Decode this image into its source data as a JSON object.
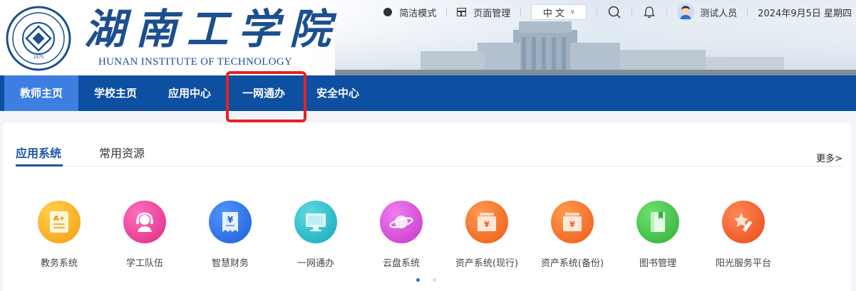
{
  "header": {
    "school_name_cn": "湖南工学院",
    "school_name_en": "HUNAN INSTITUTE OF TECHNOLOGY",
    "seal_year": "1975"
  },
  "topbar": {
    "simple_mode": "简洁模式",
    "page_manage": "页面管理",
    "language": "中 文",
    "user_name": "测试人员",
    "date": "2024年9月5日 星期四"
  },
  "nav": {
    "items": [
      {
        "label": "教师主页",
        "active": true
      },
      {
        "label": "学校主页",
        "active": false
      },
      {
        "label": "应用中心",
        "active": false
      },
      {
        "label": "一网通办",
        "active": false,
        "highlighted": true
      },
      {
        "label": "安全中心",
        "active": false
      }
    ]
  },
  "main": {
    "tabs": [
      {
        "label": "应用系统",
        "active": true
      },
      {
        "label": "常用资源",
        "active": false
      }
    ],
    "more": "更多>",
    "apps": [
      {
        "label": "教务系统",
        "icon": "grade-card-icon",
        "color": "#f5a21b"
      },
      {
        "label": "学工队伍",
        "icon": "headset-user-icon",
        "color": "#e6358f"
      },
      {
        "label": "智慧财务",
        "icon": "finance-receipt-icon",
        "color": "#2d74e6"
      },
      {
        "label": "一网通办",
        "icon": "monitor-icon",
        "color": "#1fb5c6"
      },
      {
        "label": "云盘系统",
        "icon": "planet-icon",
        "color": "#d94bd8"
      },
      {
        "label": "资产系统(现行)",
        "icon": "asset-folder-icon",
        "color": "#f26a1f"
      },
      {
        "label": "资产系统(备份)",
        "icon": "asset-folder-icon",
        "color": "#f26a1f"
      },
      {
        "label": "图书管理",
        "icon": "book-icon",
        "color": "#3cc04a"
      },
      {
        "label": "阳光服务平台",
        "icon": "star-pen-icon",
        "color": "#f2592a"
      }
    ],
    "pager": {
      "current": 1,
      "total": 2
    }
  },
  "colors": {
    "nav_bg": "#0d4fa0",
    "nav_active": "#3d7fe0",
    "brand": "#1b4f8f",
    "highlight": "#e52222"
  }
}
